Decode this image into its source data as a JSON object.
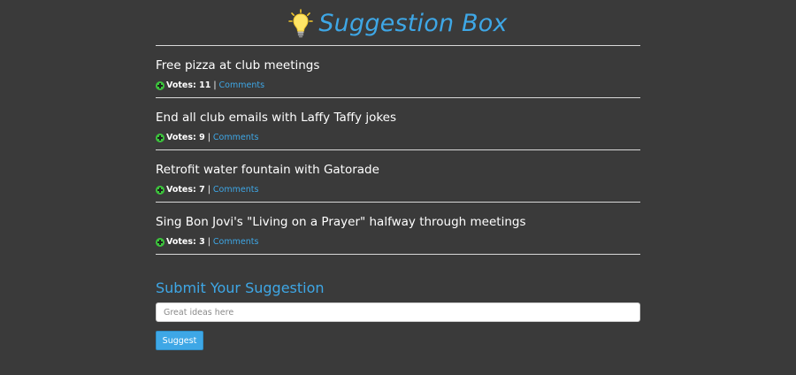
{
  "header": {
    "title": "Suggestion Box",
    "icon": "lightbulb-icon",
    "title_color": "#3ea7e6"
  },
  "suggestions": [
    {
      "title": "Free pizza at club meetings",
      "votes_label": "Votes: 11",
      "comments_label": "Comments"
    },
    {
      "title": "End all club emails with Laffy Taffy jokes",
      "votes_label": "Votes: 9",
      "comments_label": "Comments"
    },
    {
      "title": "Retrofit water fountain with Gatorade",
      "votes_label": "Votes: 7",
      "comments_label": "Comments"
    },
    {
      "title": "Sing Bon Jovi's \"Living on a Prayer\" halfway through meetings",
      "votes_label": "Votes: 3",
      "comments_label": "Comments"
    }
  ],
  "submit": {
    "heading": "Submit Your Suggestion",
    "placeholder": "Great ideas here",
    "value": "",
    "button_label": "Suggest"
  },
  "colors": {
    "background": "#3a3a3a",
    "accent": "#3ea7e6",
    "vote_icon": "#3cc43c"
  }
}
